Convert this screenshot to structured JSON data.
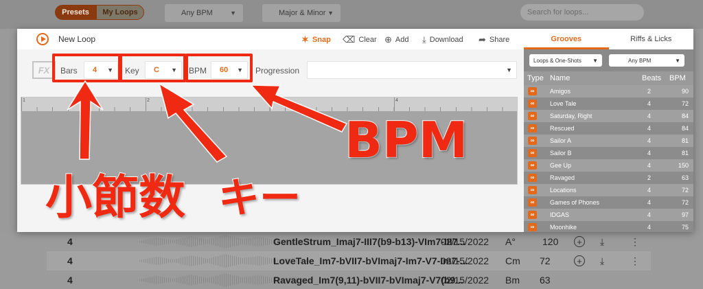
{
  "background": {
    "tabs": [
      "Presets",
      "My Loops"
    ],
    "bpm_filter": "Any BPM",
    "key_filter": "Major & Minor",
    "search_placeholder": "Search for loops...",
    "rows": [
      {
        "bars": "4",
        "name": "GentleStrum_Imaj7-III7(b9-b13)-VIm7-III7...",
        "date": "02/15/2022",
        "key": "A°",
        "bpm": "120"
      },
      {
        "bars": "4",
        "name": "LoveTale_Im7-bVII7-bVImaj7-Im7-V7-Im7-...",
        "date": "02/15/2022",
        "key": "Cm",
        "bpm": "72"
      },
      {
        "bars": "4",
        "name": "Ravaged_Im7(9,11)-bVII7-bVImaj7-V7(b9...",
        "date": "02/15/2022",
        "key": "Bm",
        "bpm": "63"
      }
    ]
  },
  "modal": {
    "title": "New Loop",
    "toolbar": {
      "snap": "Snap",
      "clear": "Clear",
      "add": "Add",
      "download": "Download",
      "share": "Share"
    },
    "fx_badge": "FX",
    "controls": {
      "bars_label": "Bars",
      "bars_value": "4",
      "key_label": "Key",
      "key_value": "C",
      "bpm_label": "BPM",
      "bpm_value": "60",
      "progression_label": "Progression",
      "progression_value": ""
    },
    "ruler_marks": [
      "1",
      "2",
      "3",
      "4"
    ]
  },
  "right_panel": {
    "tabs": [
      "Grooves",
      "Riffs & Licks"
    ],
    "filter_type": "Loops & One-Shots",
    "filter_bpm": "Any BPM",
    "columns": {
      "type": "Type",
      "name": "Name",
      "beats": "Beats",
      "bpm": "BPM"
    },
    "rows": [
      {
        "name": "Amigos",
        "beats": "2",
        "bpm": "90"
      },
      {
        "name": "Love Tale",
        "beats": "4",
        "bpm": "72"
      },
      {
        "name": "Saturday, Right",
        "beats": "4",
        "bpm": "84"
      },
      {
        "name": "Rescued",
        "beats": "4",
        "bpm": "84"
      },
      {
        "name": "Sailor A",
        "beats": "4",
        "bpm": "81"
      },
      {
        "name": "Sailor B",
        "beats": "4",
        "bpm": "81"
      },
      {
        "name": "Gee Up",
        "beats": "4",
        "bpm": "150"
      },
      {
        "name": "Ravaged",
        "beats": "2",
        "bpm": "63"
      },
      {
        "name": "Locations",
        "beats": "4",
        "bpm": "72"
      },
      {
        "name": "Games of Phones",
        "beats": "4",
        "bpm": "72"
      },
      {
        "name": "IDGAS",
        "beats": "4",
        "bpm": "97"
      },
      {
        "name": "Moonhike",
        "beats": "4",
        "bpm": "75"
      }
    ]
  },
  "annotations": {
    "bars": "小節数",
    "key": "キー",
    "bpm": "BPM",
    "color": "#f02a12"
  },
  "colors": {
    "accent": "#e36a1c",
    "annotation": "#f02a12"
  }
}
